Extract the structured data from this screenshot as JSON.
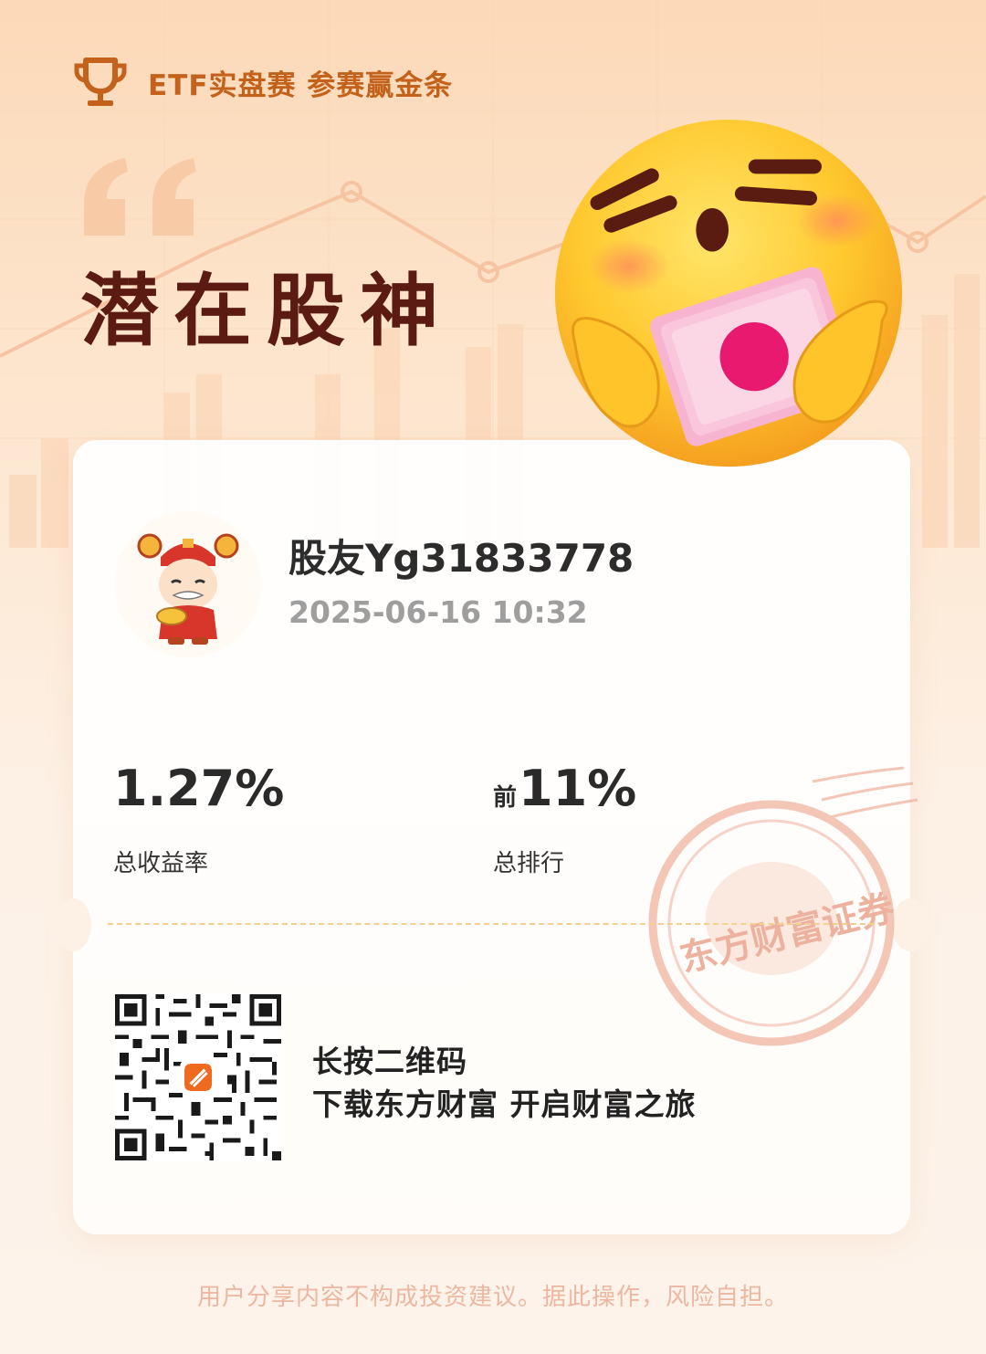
{
  "header": {
    "icon": "trophy-icon",
    "text": "ETF实盘赛 参赛赢金条"
  },
  "title": "潜在股神",
  "user": {
    "name": "股友Yg31833778",
    "datetime": "2025-06-16 10:32",
    "avatar_icon": "god-of-wealth-avatar"
  },
  "stats": {
    "return_value": "1.27%",
    "return_label": "总收益率",
    "rank_prefix": "前",
    "rank_value": "11%",
    "rank_label": "总排行"
  },
  "stamp_text": "东方财富证券",
  "cta": {
    "line1": "长按二维码",
    "line2": "下载东方财富 开启财富之旅"
  },
  "disclaimer": "用户分享内容不构成投资建议。据此操作，风险自担。",
  "colors": {
    "brand_orange": "#c4621b",
    "title_dark_red": "#5b1a12",
    "disclaimer": "#edb7a0",
    "stamp": "#e89a80"
  }
}
